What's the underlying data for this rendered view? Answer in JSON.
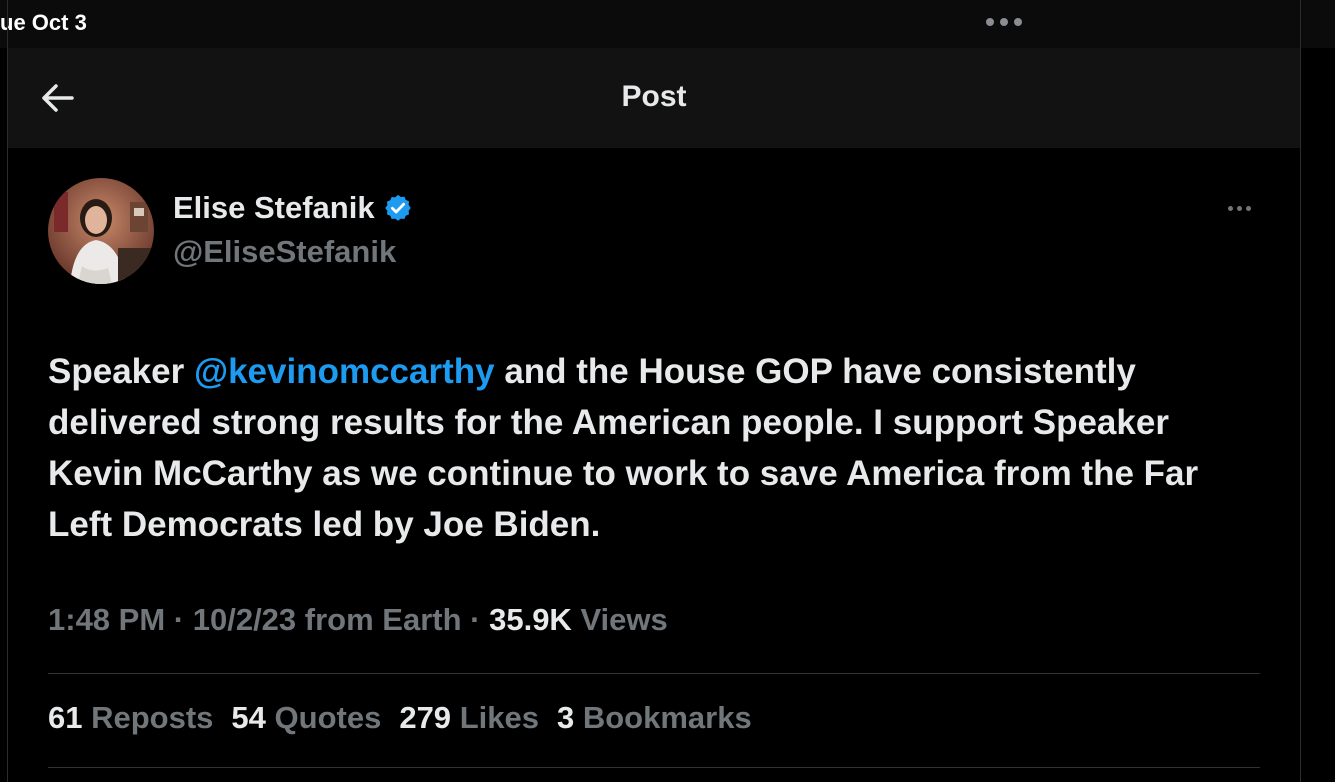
{
  "status_bar": {
    "date": "ue Oct 3"
  },
  "header": {
    "title": "Post",
    "back_icon": "arrow-left-icon"
  },
  "author": {
    "display_name": "Elise Stefanik",
    "handle": "@EliseStefanik",
    "verified_icon": "verified-badge-icon",
    "verified_color": "#1d9bf0"
  },
  "post": {
    "text_before_mention": "Speaker ",
    "mention": "@kevinomccarthy",
    "text_after_mention": " and the House GOP have consistently delivered strong results for the American people. I support Speaker Kevin McCarthy as we continue to work to save America from the Far Left Democrats led by Joe Biden."
  },
  "meta": {
    "time": "1:48 PM",
    "sep1": " · ",
    "date": "10/2/23",
    "source": " from Earth",
    "sep2": " · ",
    "views_count": "35.9K",
    "views_label": " Views"
  },
  "stats": {
    "reposts_count": "61",
    "reposts_label": "Reposts",
    "quotes_count": "54",
    "quotes_label": "Quotes",
    "likes_count": "279",
    "likes_label": "Likes",
    "bookmarks_count": "3",
    "bookmarks_label": "Bookmarks"
  },
  "colors": {
    "background": "#000000",
    "header_bg": "#121212",
    "text_primary": "#e7e9ea",
    "text_secondary": "#71767b",
    "accent": "#1d9bf0"
  }
}
